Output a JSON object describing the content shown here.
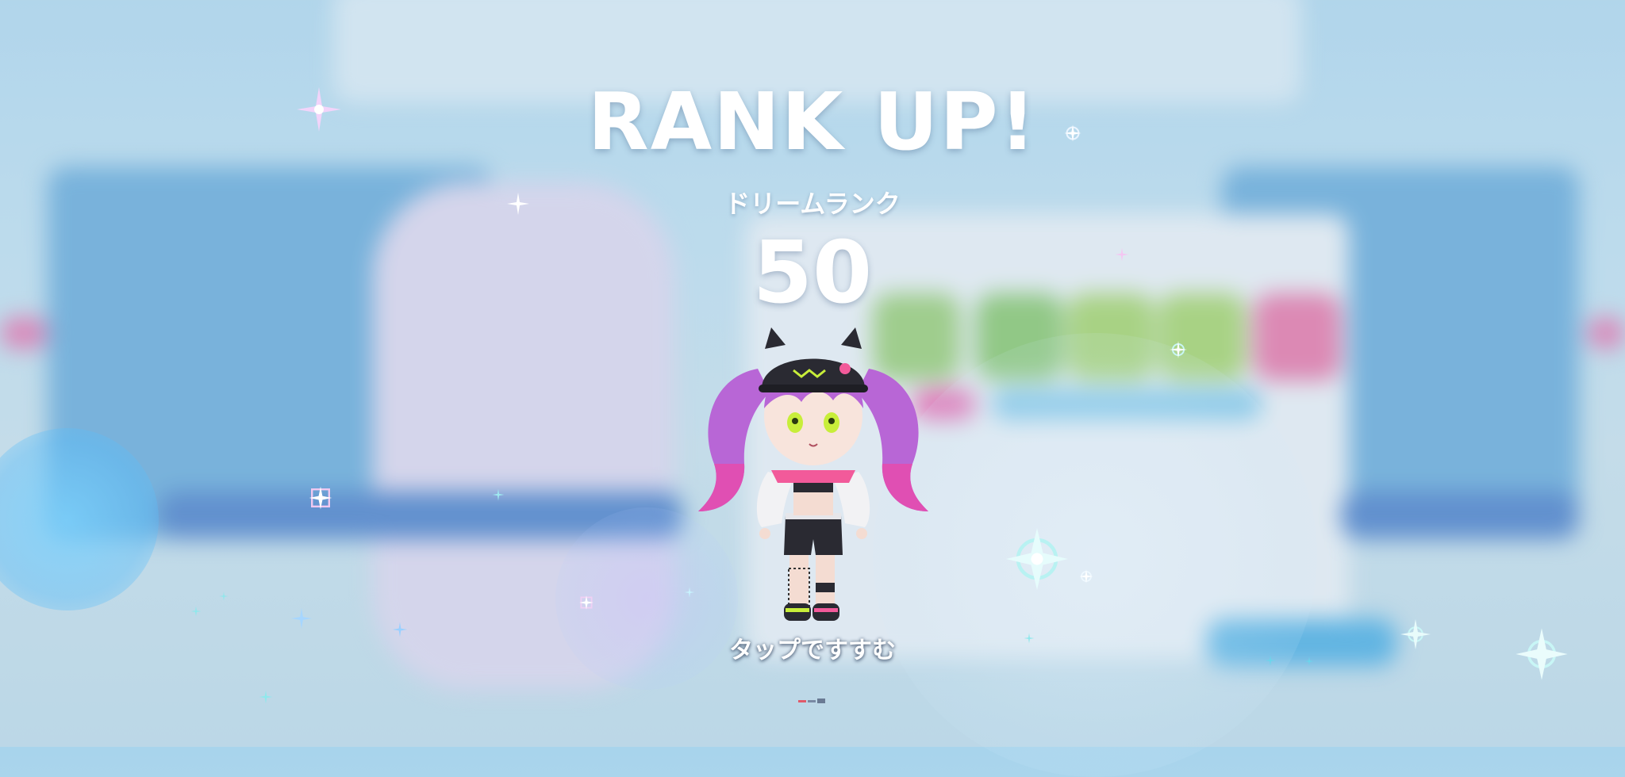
{
  "screen": {
    "title": "RANK UP!",
    "rank_label": "ドリームランク",
    "rank_value": "50",
    "prompt": "タップですすむ"
  },
  "character": {
    "hair_color": "#b866d6",
    "hair_tips_color": "#e04fb3",
    "eye_color": "#c8ee3a",
    "cap_color": "#2a2a32",
    "jacket_color": "#f2f2f4",
    "accent_color": "#f25a9a"
  },
  "colors": {
    "title_text": "#ffffff",
    "background": "#b9dcee",
    "sparkle_pink": "#e9b6f2",
    "sparkle_cyan": "#8fe8ec"
  },
  "icons": [
    "sparkle-icon",
    "page-indicator-dots"
  ]
}
